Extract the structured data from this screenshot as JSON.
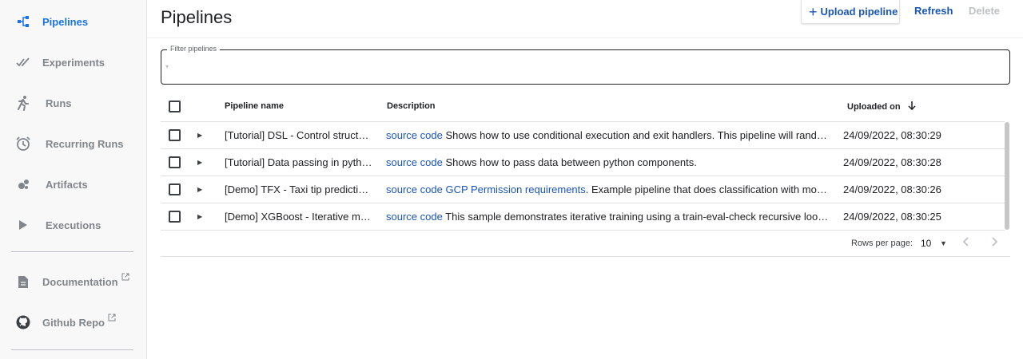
{
  "sidebar": {
    "items": [
      {
        "label": "Pipelines",
        "icon": "pipelines-icon",
        "active": true
      },
      {
        "label": "Experiments",
        "icon": "experiments-icon"
      },
      {
        "label": "Runs",
        "icon": "runs-icon"
      },
      {
        "label": "Recurring Runs",
        "icon": "alarm-clock-icon"
      },
      {
        "label": "Artifacts",
        "icon": "artifacts-icon"
      },
      {
        "label": "Executions",
        "icon": "play-icon"
      }
    ],
    "links": [
      {
        "label": "Documentation",
        "icon": "document-icon"
      },
      {
        "label": "Github Repo",
        "icon": "github-icon"
      }
    ]
  },
  "header": {
    "title": "Pipelines",
    "upload_label": "Upload pipeline",
    "refresh_label": "Refresh",
    "delete_label": "Delete"
  },
  "filter": {
    "label": "Filter pipelines",
    "value": ""
  },
  "table": {
    "columns": {
      "name": "Pipeline name",
      "description": "Description",
      "uploaded": "Uploaded on"
    },
    "rows": [
      {
        "name": "[Tutorial] DSL - Control structures",
        "desc_link": "source code",
        "desc_link2": "",
        "desc_text": " Shows how to use conditional execution and exit handlers. This pipeline will randomly fail to demonstrate that the exit handler gets executed even in case of failure.",
        "uploaded": "24/09/2022, 08:30:29"
      },
      {
        "name": "[Tutorial] Data passing in python components",
        "desc_link": "source code",
        "desc_link2": "",
        "desc_text": " Shows how to pass data between python components.",
        "uploaded": "24/09/2022, 08:30:28"
      },
      {
        "name": "[Demo] TFX - Taxi tip prediction model trainer",
        "desc_link": "source code",
        "desc_link2": "GCP Permission requirements",
        "desc_text": ". Example pipeline that does classification with model analysis based on a public tax cab dataset.",
        "uploaded": "24/09/2022, 08:30:26"
      },
      {
        "name": "[Demo] XGBoost - Iterative model training",
        "desc_link": "source code",
        "desc_link2": "",
        "desc_text": " This sample demonstrates iterative training using a train-eval-check recursive loop. The main pipeline trains the initial model and then gradually trains the model some more until the model evaluation metrics are good enough.",
        "uploaded": "24/09/2022, 08:30:25"
      }
    ]
  },
  "pagination": {
    "rows_per_page_label": "Rows per page:",
    "rows_per_page_value": "10"
  },
  "colors": {
    "accent": "#1a73e8",
    "link": "#1a55b8",
    "muted": "#80868b"
  }
}
